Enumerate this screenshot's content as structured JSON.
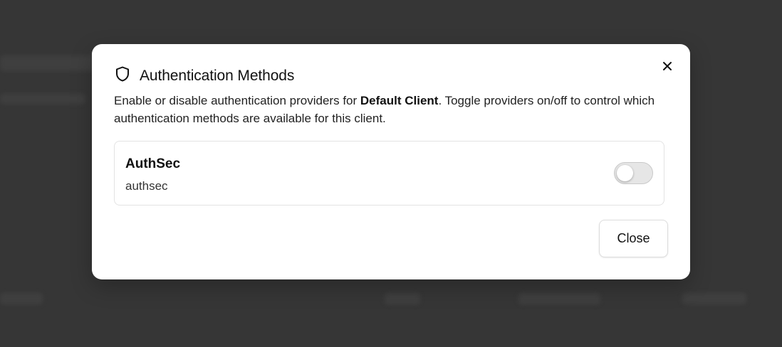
{
  "modal": {
    "title": "Authentication Methods",
    "description_prefix": "Enable or disable authentication providers for ",
    "client_name": "Default Client",
    "description_suffix": ". Toggle providers on/off to control which authentication methods are available for this client.",
    "close_button_label": "Close"
  },
  "providers": [
    {
      "name": "AuthSec",
      "id": "authsec",
      "enabled": false
    }
  ],
  "icons": {
    "title_icon": "shield-icon",
    "close_icon": "close-icon"
  }
}
